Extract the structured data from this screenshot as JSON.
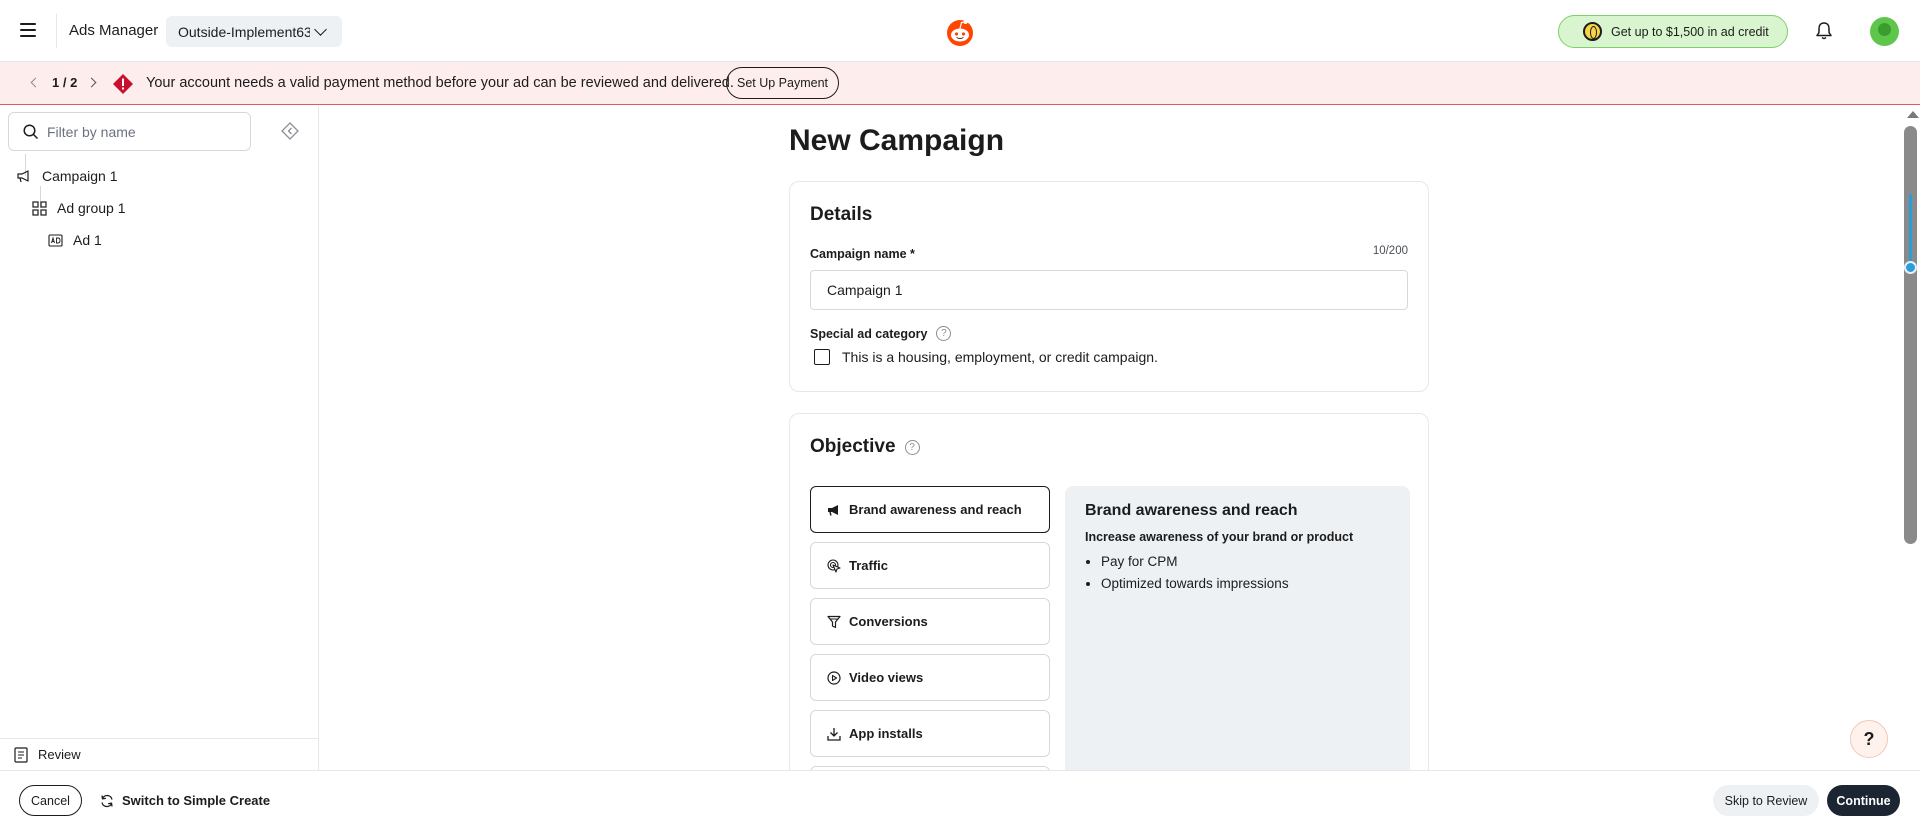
{
  "header": {
    "app_title": "Ads Manager",
    "account_name": "Outside-Implement63",
    "credit_offer": "Get up to $1,500 in ad credit",
    "brand_color": "#ff4500",
    "icons": [
      "menu-icon",
      "chevron-down-icon",
      "reddit-logo",
      "coin-icon",
      "bell-icon",
      "avatar"
    ]
  },
  "alert": {
    "pager": "1 / 2",
    "message": "Your account needs a valid payment method before your ad can be reviewed and delivered.",
    "action_label": "Set Up Payment",
    "accent_color": "#d0021b"
  },
  "sidebar": {
    "filter_placeholder": "Filter by name",
    "tree": [
      {
        "label": "Campaign 1",
        "icon": "megaphone-icon"
      },
      {
        "label": "Ad group 1",
        "icon": "grid-icon"
      },
      {
        "label": "Ad 1",
        "icon": "ad-icon"
      }
    ],
    "review_label": "Review"
  },
  "main": {
    "page_title": "New Campaign",
    "details": {
      "title": "Details",
      "campaign_name_label": "Campaign name *",
      "campaign_name_counter": "10/200",
      "campaign_name_value": "Campaign 1",
      "special_category_label": "Special ad category",
      "special_category_checkbox": "This is a housing, employment, or credit campaign.",
      "special_category_checked": false
    },
    "objective": {
      "title": "Objective",
      "options": [
        {
          "label": "Brand awareness and reach",
          "icon": "megaphone-icon",
          "selected": true
        },
        {
          "label": "Traffic",
          "icon": "cursor-click-icon",
          "selected": false
        },
        {
          "label": "Conversions",
          "icon": "funnel-icon",
          "selected": false
        },
        {
          "label": "Video views",
          "icon": "play-circle-icon",
          "selected": false
        },
        {
          "label": "App installs",
          "icon": "download-icon",
          "selected": false
        }
      ],
      "panel": {
        "title": "Brand awareness and reach",
        "subtitle": "Increase awareness of your brand or product",
        "bullets": [
          "Pay for CPM",
          "Optimized towards impressions"
        ]
      }
    }
  },
  "help_fab_label": "?",
  "footer": {
    "cancel_label": "Cancel",
    "switch_label": "Switch to Simple Create",
    "skip_label": "Skip to Review",
    "continue_label": "Continue"
  }
}
